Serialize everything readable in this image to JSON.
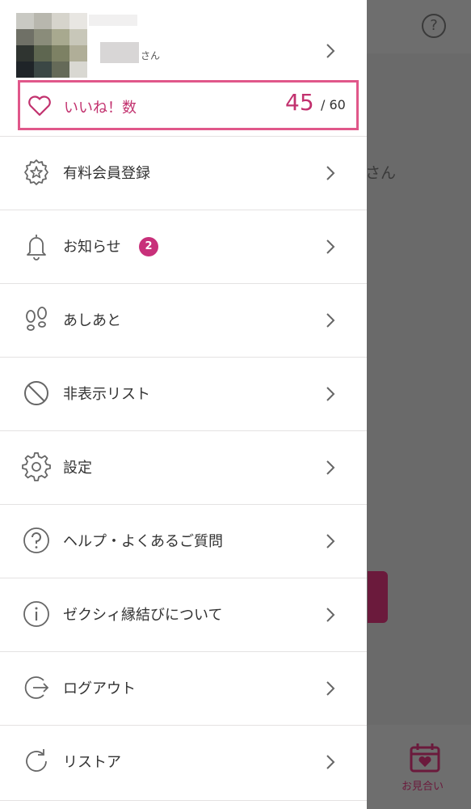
{
  "background": {
    "help_icon_glyph": "?",
    "partial_text": "さん",
    "bottom_tab_label": "お見合い"
  },
  "profile": {
    "name_suffix": "さん"
  },
  "likes": {
    "label": "いいね！数",
    "count": "45",
    "max": "/ 60"
  },
  "menu": [
    {
      "label": "有料会員登録",
      "icon": "paid-badge-icon"
    },
    {
      "label": "お知らせ",
      "icon": "bell-icon",
      "badge": "2"
    },
    {
      "label": "あしあと",
      "icon": "footprints-icon"
    },
    {
      "label": "非表示リスト",
      "icon": "prohibited-icon"
    },
    {
      "label": "設定",
      "icon": "gear-icon"
    },
    {
      "label": "ヘルプ・よくあるご質問",
      "icon": "help-icon"
    },
    {
      "label": "ゼクシィ縁結びについて",
      "icon": "info-icon"
    },
    {
      "label": "ログアウト",
      "icon": "logout-icon"
    },
    {
      "label": "リストア",
      "icon": "restore-icon"
    }
  ],
  "colors": {
    "accent": "#c2316e",
    "badge": "#c8307a",
    "highlight_border": "#e0578a"
  }
}
